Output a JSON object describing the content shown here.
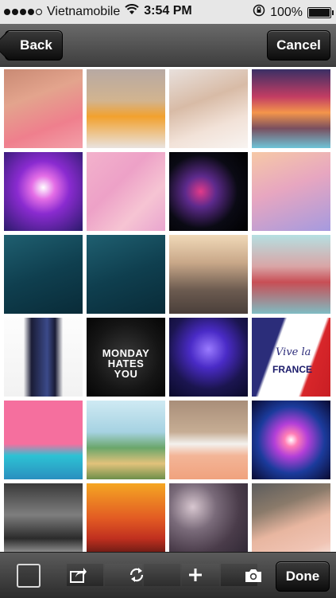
{
  "status_bar": {
    "carrier": "Vietnamobile",
    "time": "3:54 PM",
    "battery": "100%",
    "signal_icon": "signal-dots-icon",
    "wifi_icon": "wifi-icon",
    "lock_icon": "rotation-lock-icon",
    "battery_icon": "battery-full-icon"
  },
  "nav": {
    "back_label": "Back",
    "cancel_label": "Cancel"
  },
  "grid": {
    "tiles": [
      {
        "bg": "linear-gradient(160deg,#c98a74 0%,#e3a48d 35%,#ef7f8d 70%,#f3a0a9 100%)"
      },
      {
        "bg": "linear-gradient(180deg,#b7a9a3 0%,#d2b48f 40%,#f2a12e 60%,#e9e3df 100%)"
      },
      {
        "bg": "linear-gradient(160deg,#e8e0dc 0%,#d8bba6 40%,#f2e2d8 70%,#f8f4f1 100%)"
      },
      {
        "bg": "linear-gradient(180deg,#3a2f65 0%,#c33d63 35%,#f4954b 55%,#7a4f5f 75%,#6ec4d8 100%)"
      },
      {
        "bg": "radial-gradient(circle at 50% 45%,#ffffff 0%,#e46ee6 20%,#8a2bd0 45%,#2a1a6a 100%)"
      },
      {
        "bg": "linear-gradient(135deg,#f3b2cc 0%,#eda1c7 40%,#f6c4d3 70%,#e9a5cf 100%)"
      },
      {
        "bg": "radial-gradient(circle at 40% 50%,#e23a8a 0%,#5d2a8c 25%,#0a0a14 60%,#000 100%)"
      },
      {
        "bg": "linear-gradient(160deg,#f6c9a6 0%,#e7a6c0 45%,#a59adf 100%)"
      },
      {
        "bg": "linear-gradient(160deg,#1f5f70 0%,#0f3f4f 50%,#092b38 100%)"
      },
      {
        "bg": "linear-gradient(160deg,#1f5f70 0%,#0f3f4f 50%,#092b38 100%)"
      },
      {
        "bg": "linear-gradient(180deg,#f0d9b8 0%,#c9a889 35%,#6c5b50 70%,#4a3f3a 100%)"
      },
      {
        "bg": "linear-gradient(180deg,#b5e0e2 0%,#d9a5a6 40%,#c84e55 60%,#7fbcc3 100%)"
      },
      {
        "bg": "linear-gradient(180deg,#fdfdfd 0%,#f2f2f2 100%)",
        "overlay": "linear-gradient(90deg,transparent 25%,#1a1c36 35%,#3b4a8a 55%,#1a1c36 65%,transparent 75%)"
      },
      {
        "bg": "radial-gradient(circle at 50% 50%,#3a3a3a 0%,#151515 60%,#050505 100%)",
        "caption": "MONDAY\nHATES\nYOU"
      },
      {
        "bg": "radial-gradient(circle at 50% 40%,#9a7bff 0%,#4a2bc7 30%,#1b1550 65%,#0a0a2a 100%)"
      },
      {
        "bg": "linear-gradient(110deg,#2b2d7a 0%,#2b2d7a 30%,#ffffff 33%,#ffffff 70%,#d8262a 73%,#c81e24 100%)",
        "caption2": "Vive la",
        "caption3": "FRANCE"
      },
      {
        "bg": "linear-gradient(180deg,#f56f9e 0%,#f56f9e 55%,#2dc2d4 70%,#2a8fbf 100%)"
      },
      {
        "bg": "linear-gradient(180deg,#cfeaf3 0%,#a6d2e2 40%,#6aa66a 60%,#e2c27b 80%,#6d8f4a 100%)"
      },
      {
        "bg": "linear-gradient(180deg,#a98e79 0%,#c6ad94 40%,#f3f1ee 55%,#f3b597 70%,#f0a27e 100%)"
      },
      {
        "bg": "radial-gradient(circle at 50% 50%,#ffffff 0%,#ff7eb6 12%,#b33fd8 30%,#1b3b9c 60%,#0a0a30 100%)"
      },
      {
        "bg": "linear-gradient(180deg,#3a3a3a 0%,#7e7e7e 40%,#2b2b2b 70%,#d6d6d6 100%)"
      },
      {
        "bg": "linear-gradient(180deg,#f5a623 0%,#e25a23 45%,#c0301f 70%,#3a0f0f 100%)"
      },
      {
        "bg": "radial-gradient(circle at 30% 30%,#d8c7d0 0%,#7a6b7a 30%,#4a3c4a 60%,#2a2430 100%)"
      },
      {
        "bg": "linear-gradient(160deg,#5c5c5c 0%,#8a7a6a 30%,#e8b6a0 55%,#f0c4b4 80%,#f8ece8 100%)"
      }
    ]
  },
  "toolbar": {
    "done_label": "Done",
    "select_icon": "select-all-checkbox-icon",
    "share_icon": "share-icon",
    "rotate_icon": "rotate-icon",
    "add_icon": "plus-icon",
    "camera_icon": "camera-icon"
  }
}
